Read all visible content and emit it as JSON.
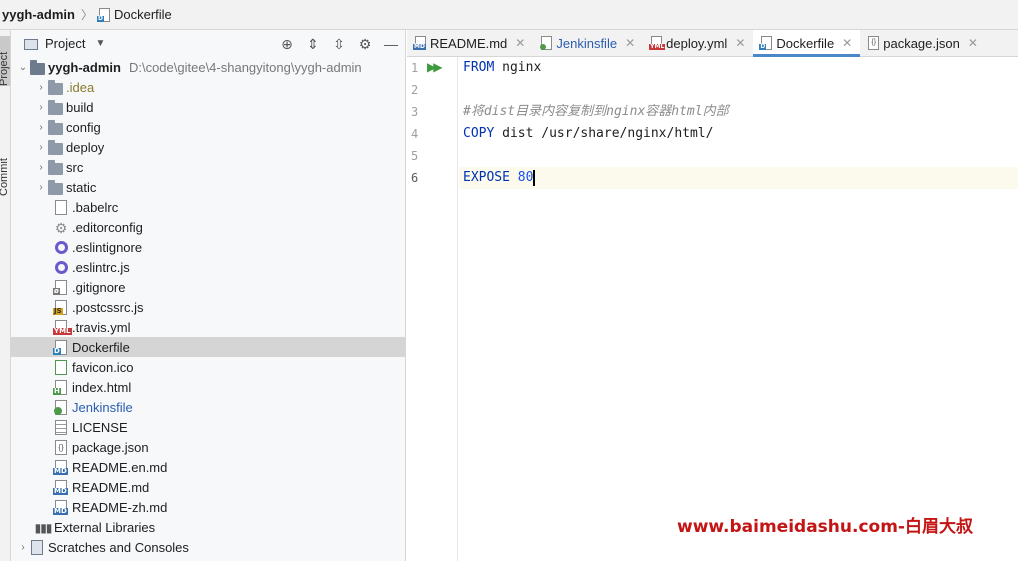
{
  "breadcrumb": {
    "project": "yygh-admin",
    "file": "Dockerfile"
  },
  "toolstrip": {
    "project_tab": "Project",
    "commit_tab": "Commit"
  },
  "project_panel": {
    "title": "Project",
    "root": {
      "name": "yygh-admin",
      "path": "D:\\code\\gitee\\4-shangyitong\\yygh-admin"
    },
    "folders": [
      ".idea",
      "build",
      "config",
      "deploy",
      "src",
      "static"
    ],
    "files": [
      {
        "name": ".babelrc",
        "icon": "babelrc-file-icon"
      },
      {
        "name": ".editorconfig",
        "icon": "gear-file-icon"
      },
      {
        "name": ".eslintignore",
        "icon": "eslint-icon"
      },
      {
        "name": ".eslintrc.js",
        "icon": "eslint-icon"
      },
      {
        "name": ".gitignore",
        "icon": "gitignore-file-icon"
      },
      {
        "name": ".postcssrc.js",
        "icon": "js-file-icon"
      },
      {
        "name": ".travis.yml",
        "icon": "yml-file-icon"
      },
      {
        "name": "Dockerfile",
        "icon": "docker-file-icon"
      },
      {
        "name": "favicon.ico",
        "icon": "image-file-icon"
      },
      {
        "name": "index.html",
        "icon": "html-file-icon"
      },
      {
        "name": "Jenkinsfile",
        "icon": "jenkins-file-icon"
      },
      {
        "name": "LICENSE",
        "icon": "text-file-icon"
      },
      {
        "name": "package.json",
        "icon": "json-file-icon"
      },
      {
        "name": "README.en.md",
        "icon": "md-file-icon"
      },
      {
        "name": "README.md",
        "icon": "md-file-icon"
      },
      {
        "name": "README-zh.md",
        "icon": "md-file-icon"
      }
    ],
    "external_libraries": "External Libraries",
    "scratches": "Scratches and Consoles",
    "selected_file": "Dockerfile"
  },
  "tabs": [
    {
      "label": "README.md",
      "tag": "MD",
      "active": false
    },
    {
      "label": "Jenkinsfile",
      "tag": "",
      "active": false
    },
    {
      "label": "deploy.yml",
      "tag": "YML",
      "active": false
    },
    {
      "label": "Dockerfile",
      "tag": "D",
      "active": true
    },
    {
      "label": "package.json",
      "tag": "{}",
      "active": false
    }
  ],
  "editor": {
    "line_numbers": [
      "1",
      "2",
      "3",
      "4",
      "5",
      "6"
    ],
    "current_line": 6,
    "lines": [
      [
        {
          "t": "FROM",
          "c": "kw"
        },
        {
          "t": " nginx",
          "c": "txt"
        }
      ],
      [],
      [
        {
          "t": "#将dist目录内容复制到nginx容器html内部",
          "c": "cmt"
        }
      ],
      [
        {
          "t": "COPY",
          "c": "kw"
        },
        {
          "t": " dist /usr/share/nginx/html/",
          "c": "txt"
        }
      ],
      [],
      [
        {
          "t": "EXPOSE",
          "c": "kw"
        },
        {
          "t": " ",
          "c": "txt"
        },
        {
          "t": "80",
          "c": "num"
        }
      ]
    ]
  },
  "watermark": "www.baimeidashu.com-白眉大叔",
  "colors": {
    "keyword": "#0033b3",
    "number": "#1750eb",
    "comment": "#8c8c8c",
    "accent": "#4a88c7",
    "selection": "#d5d5d5",
    "watermark": "#c41414"
  }
}
